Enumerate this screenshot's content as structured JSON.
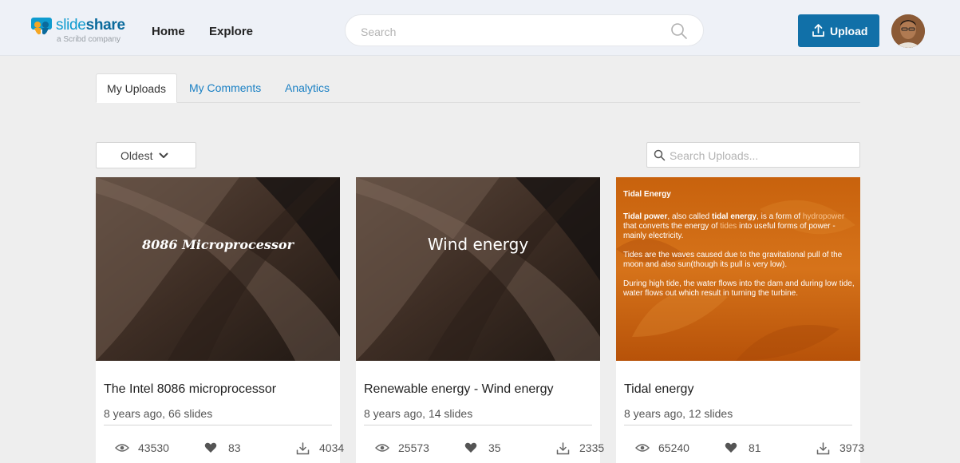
{
  "header": {
    "logo_word_1": "slide",
    "logo_word_2": "share",
    "logo_sub": "a Scribd company",
    "nav_home": "Home",
    "nav_explore": "Explore",
    "search_placeholder": "Search",
    "upload_label": "Upload",
    "colors": {
      "brand": "#0e9bcf",
      "upload_button": "#1170a8",
      "link": "#1a80c4"
    }
  },
  "tabs": [
    {
      "label": "My Uploads",
      "active": true
    },
    {
      "label": "My Comments",
      "active": false
    },
    {
      "label": "Analytics",
      "active": false
    }
  ],
  "sort": {
    "selected": "Oldest"
  },
  "upload_search": {
    "placeholder": "Search Uploads..."
  },
  "cards": [
    {
      "thumb_text": "8086 Microprocessor",
      "title": "The Intel 8086 microprocessor",
      "meta": "8 years ago, 66 slides",
      "views": "43530",
      "likes": "83",
      "downloads": "4034"
    },
    {
      "thumb_text": "Wind energy",
      "title": "Renewable energy - Wind energy",
      "meta": "8 years ago, 14 slides",
      "views": "25573",
      "likes": "35",
      "downloads": "2335"
    },
    {
      "thumb": {
        "heading": "Tidal Energy",
        "p1_bold1": "Tidal power",
        "p1_t1": ", also called ",
        "p1_bold2": "tidal energy",
        "p1_t2": ", is a form of ",
        "p1_link1": "hydropower",
        "p1_t3": " that converts the energy of ",
        "p1_link2": "tides",
        "p1_t4": " into useful forms of power - mainly electricity.",
        "p2": "Tides are the waves caused due to the gravitational pull of the moon and also sun(though its pull is very low).",
        "p3": "During high tide, the water flows into the dam and during low tide, water flows out which result in turning the turbine."
      },
      "title": "Tidal energy",
      "meta": "8 years ago, 12 slides",
      "views": "65240",
      "likes": "81",
      "downloads": "3973"
    }
  ]
}
